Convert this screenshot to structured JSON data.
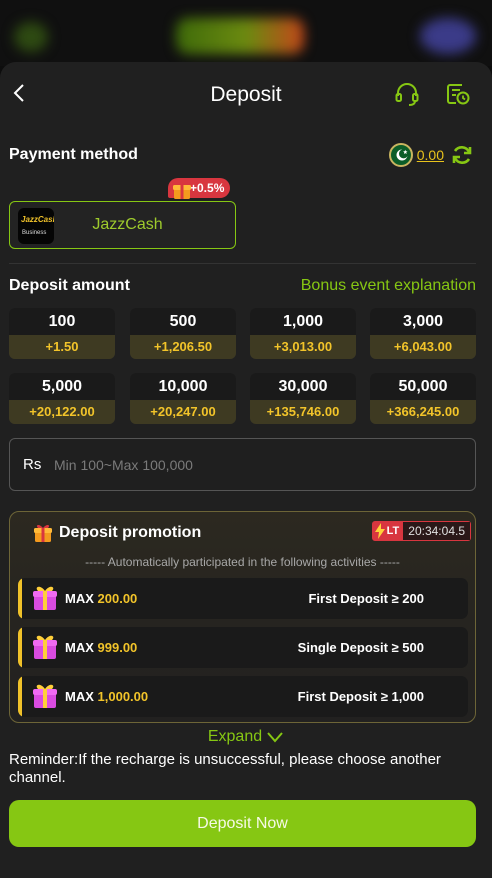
{
  "header": {
    "title": "Deposit",
    "back_icon": "chevron-left-icon",
    "support_icon": "headset-icon",
    "history_icon": "record-clock-icon"
  },
  "payment_method": {
    "label": "Payment method",
    "balance": "0.00",
    "flag_icon": "pakistan-flag-icon",
    "refresh_icon": "refresh-icon",
    "selected": {
      "name": "JazzCash",
      "logo_text": "JazzCash",
      "logo_sub": "Business",
      "bonus_badge": "+0.5%"
    }
  },
  "deposit_amount": {
    "label": "Deposit amount",
    "bonus_link": "Bonus event explanation",
    "options": [
      {
        "amount": "100",
        "bonus": "+1.50"
      },
      {
        "amount": "500",
        "bonus": "+1,206.50"
      },
      {
        "amount": "1,000",
        "bonus": "+3,013.00"
      },
      {
        "amount": "3,000",
        "bonus": "+6,043.00"
      },
      {
        "amount": "5,000",
        "bonus": "+20,122.00"
      },
      {
        "amount": "10,000",
        "bonus": "+20,247.00"
      },
      {
        "amount": "30,000",
        "bonus": "+135,746.00"
      },
      {
        "amount": "50,000",
        "bonus": "+366,245.00"
      }
    ],
    "currency": "Rs",
    "placeholder": "Min 100~Max 100,000"
  },
  "promotion": {
    "title": "Deposit promotion",
    "badge": "LT",
    "countdown": "20:34:04.5",
    "subtitle": "----- Automatically participated in the following activities -----",
    "items": [
      {
        "max_label": "MAX",
        "max_value": "200.00",
        "condition": "First Deposit ≥ 200"
      },
      {
        "max_label": "MAX",
        "max_value": "999.00",
        "condition": "Single Deposit ≥ 500"
      },
      {
        "max_label": "MAX",
        "max_value": "1,000.00",
        "condition": "First Deposit ≥ 1,000"
      }
    ]
  },
  "expand_label": "Expand",
  "reminder": "Reminder:If the recharge is unsuccessful, please choose another channel.",
  "deposit_button": "Deposit Now",
  "colors": {
    "accent": "#86c713",
    "gold": "#f2c42a",
    "danger": "#d8363f",
    "sheet": "#202020"
  }
}
